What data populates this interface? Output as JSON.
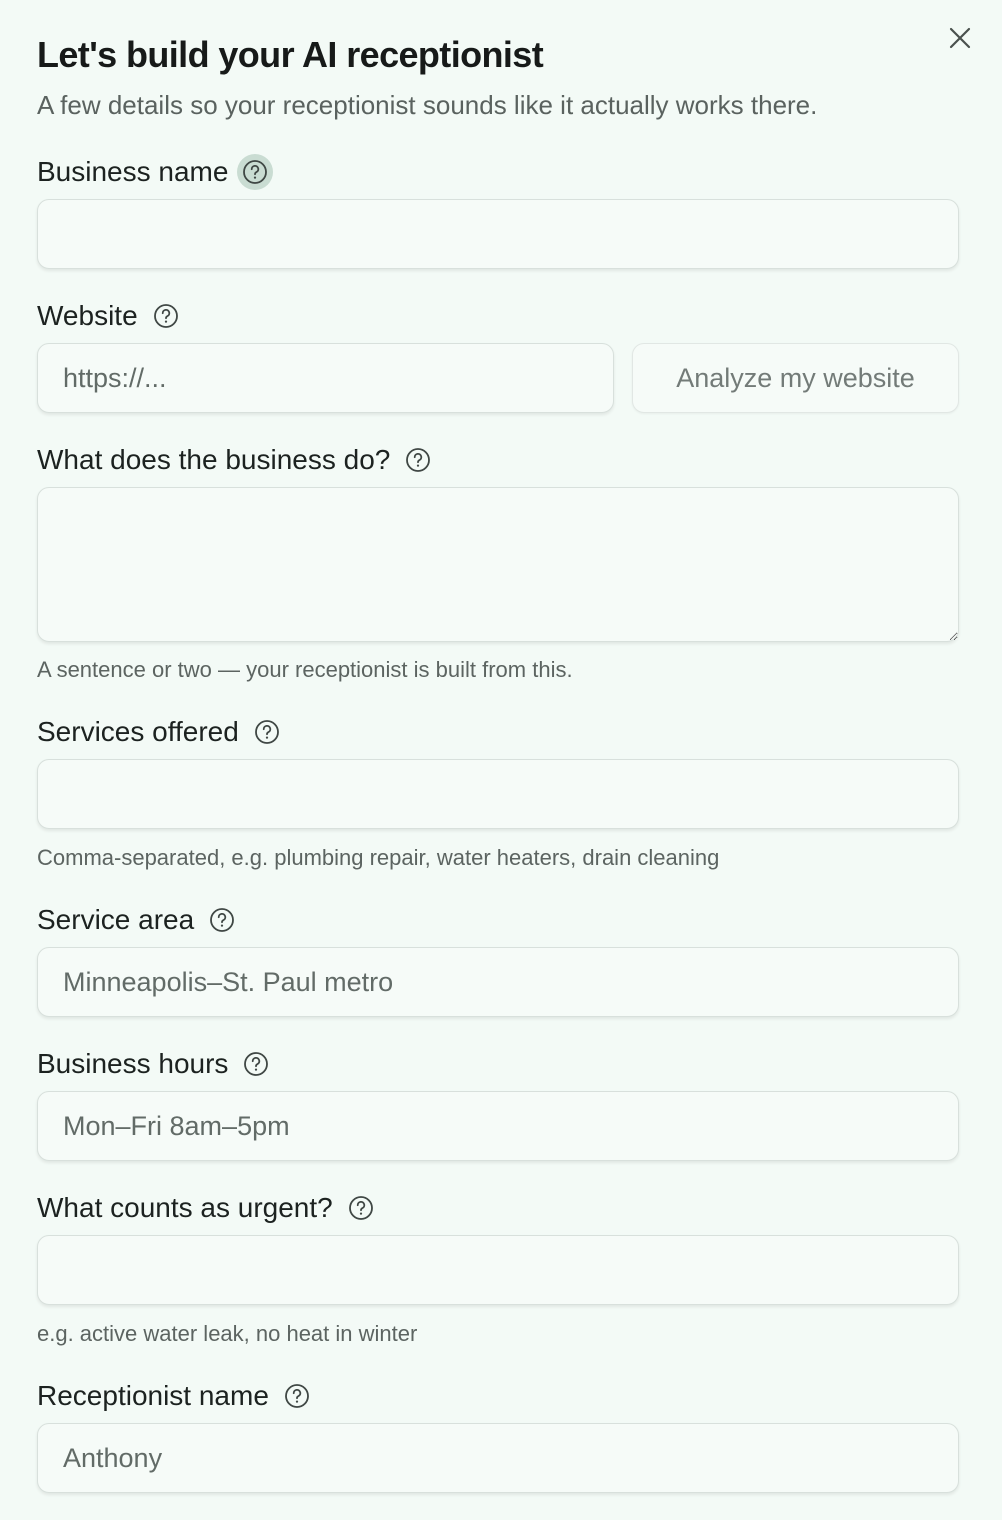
{
  "header": {
    "title": "Let's build your AI receptionist",
    "subtitle": "A few details so your receptionist sounds like it actually works there."
  },
  "icons": {
    "close": "close-icon",
    "help": "question-circle-icon"
  },
  "fields": {
    "business_name": {
      "label": "Business name",
      "value": "",
      "placeholder": ""
    },
    "website": {
      "label": "Website",
      "value": "",
      "placeholder": "https://...",
      "button_label": "Analyze my website"
    },
    "business_description": {
      "label": "What does the business do?",
      "value": "",
      "placeholder": "",
      "hint": "A sentence or two — your receptionist is built from this."
    },
    "services": {
      "label": "Services offered",
      "value": "",
      "placeholder": "",
      "hint": "Comma-separated, e.g. plumbing repair, water heaters, drain cleaning"
    },
    "service_area": {
      "label": "Service area",
      "value": "",
      "placeholder": "Minneapolis–St. Paul metro"
    },
    "business_hours": {
      "label": "Business hours",
      "value": "",
      "placeholder": "Mon–Fri 8am–5pm"
    },
    "urgent": {
      "label": "What counts as urgent?",
      "value": "",
      "placeholder": "",
      "hint": "e.g. active water leak, no heat in winter"
    },
    "receptionist_name": {
      "label": "Receptionist name",
      "value": "",
      "placeholder": "Anthony"
    }
  },
  "colors": {
    "background": "#f3faf6",
    "help_active": "#c9dcd2",
    "text": "#1c2220",
    "muted": "#5c6461"
  }
}
